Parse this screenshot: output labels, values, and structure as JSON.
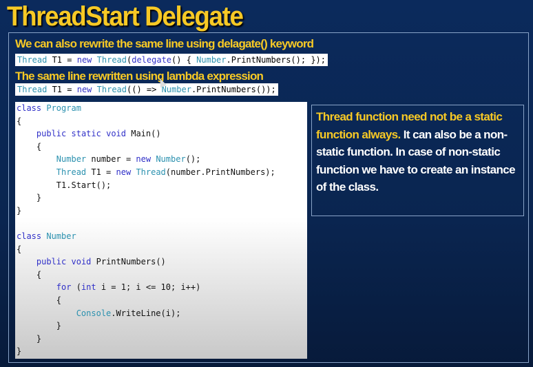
{
  "slide": {
    "title": "ThreadStart Delegate",
    "heading_delegate": "We can also rewrite the same line using delagate() keyword",
    "heading_lambda": "The same line rewritten using lambda expression",
    "delegate_code": [
      [
        "Thread",
        "ty"
      ],
      [
        " T1 = ",
        ""
      ],
      [
        "new",
        "kw"
      ],
      [
        " ",
        ""
      ],
      [
        "Thread",
        "ty"
      ],
      [
        "(",
        ""
      ],
      [
        "delegate",
        "kw"
      ],
      [
        "() { ",
        ""
      ],
      [
        "Number",
        "ty"
      ],
      [
        ".PrintNumbers(); });",
        ""
      ]
    ],
    "lambda_code": [
      [
        "Thread",
        "ty"
      ],
      [
        " T1 = ",
        ""
      ],
      [
        "new",
        "kw"
      ],
      [
        " ",
        ""
      ],
      [
        "Thread",
        "ty"
      ],
      [
        "(() => ",
        ""
      ],
      [
        "Number",
        "ty"
      ],
      [
        ".PrintNumbers());",
        ""
      ]
    ],
    "code_lines": [
      [
        [
          "class",
          "kw"
        ],
        [
          " ",
          ""
        ],
        [
          "Program",
          "ty"
        ]
      ],
      [
        [
          "{",
          ""
        ]
      ],
      [
        [
          "    ",
          ""
        ],
        [
          "public",
          "kw"
        ],
        [
          " ",
          ""
        ],
        [
          "static",
          "kw"
        ],
        [
          " ",
          ""
        ],
        [
          "void",
          "kw"
        ],
        [
          " Main()",
          ""
        ]
      ],
      [
        [
          "    {",
          ""
        ]
      ],
      [
        [
          "        ",
          ""
        ],
        [
          "Number",
          "ty"
        ],
        [
          " number = ",
          ""
        ],
        [
          "new",
          "kw"
        ],
        [
          " ",
          ""
        ],
        [
          "Number",
          "ty"
        ],
        [
          "();",
          ""
        ]
      ],
      [
        [
          "        ",
          ""
        ],
        [
          "Thread",
          "ty"
        ],
        [
          " T1 = ",
          ""
        ],
        [
          "new",
          "kw"
        ],
        [
          " ",
          ""
        ],
        [
          "Thread",
          "ty"
        ],
        [
          "(number.PrintNumbers);",
          ""
        ]
      ],
      [
        [
          "        T1.Start();",
          ""
        ]
      ],
      [
        [
          "    }",
          ""
        ]
      ],
      [
        [
          "}",
          ""
        ]
      ],
      [
        [
          "",
          ""
        ]
      ],
      [
        [
          "class",
          "kw"
        ],
        [
          " ",
          ""
        ],
        [
          "Number",
          "ty"
        ]
      ],
      [
        [
          "{",
          ""
        ]
      ],
      [
        [
          "    ",
          ""
        ],
        [
          "public",
          "kw"
        ],
        [
          " ",
          ""
        ],
        [
          "void",
          "kw"
        ],
        [
          " PrintNumbers()",
          ""
        ]
      ],
      [
        [
          "    {",
          ""
        ]
      ],
      [
        [
          "        ",
          ""
        ],
        [
          "for",
          "kw"
        ],
        [
          " (",
          ""
        ],
        [
          "int",
          "kw"
        ],
        [
          " i = 1; i <= 10; i++)",
          ""
        ]
      ],
      [
        [
          "        {",
          ""
        ]
      ],
      [
        [
          "            ",
          ""
        ],
        [
          "Console",
          "ty"
        ],
        [
          ".WriteLine(i);",
          ""
        ]
      ],
      [
        [
          "        }",
          ""
        ]
      ],
      [
        [
          "    }",
          ""
        ]
      ],
      [
        [
          "}",
          ""
        ]
      ]
    ],
    "note_highlight": "Thread function need not be a static function always.",
    "note_rest": " It can also be a non-static function. In case of non-static function we have to create an instance of the class.",
    "colors": {
      "title": "#f7c925",
      "keyword": "#3030c8",
      "type": "#2b91af",
      "background": "#0b2a5c"
    }
  }
}
